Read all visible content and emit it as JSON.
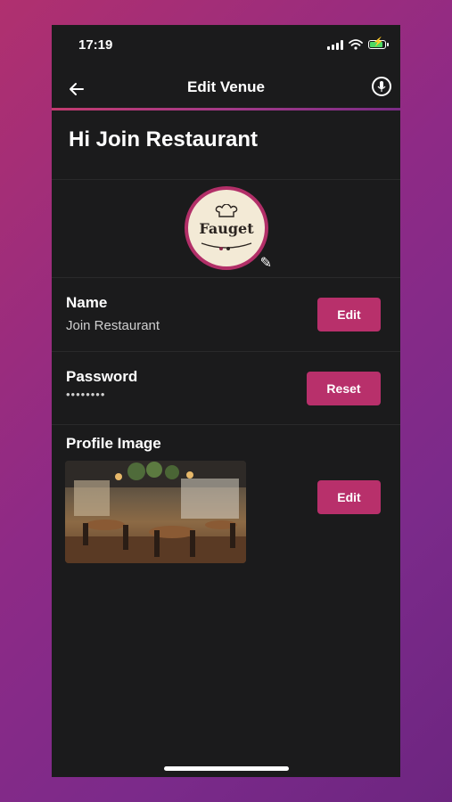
{
  "status_bar": {
    "time": "17:19"
  },
  "nav": {
    "title": "Edit Venue"
  },
  "greeting": "Hi Join Restaurant",
  "venue_logo": {
    "text": "Fauget"
  },
  "name_field": {
    "label": "Name",
    "value": "Join Restaurant",
    "button": "Edit"
  },
  "password_field": {
    "label": "Password",
    "value": "••••••••",
    "button": "Reset"
  },
  "profile_image": {
    "label": "Profile Image",
    "button": "Edit"
  },
  "colors": {
    "accent": "#b8306b",
    "background": "#1b1b1c"
  }
}
